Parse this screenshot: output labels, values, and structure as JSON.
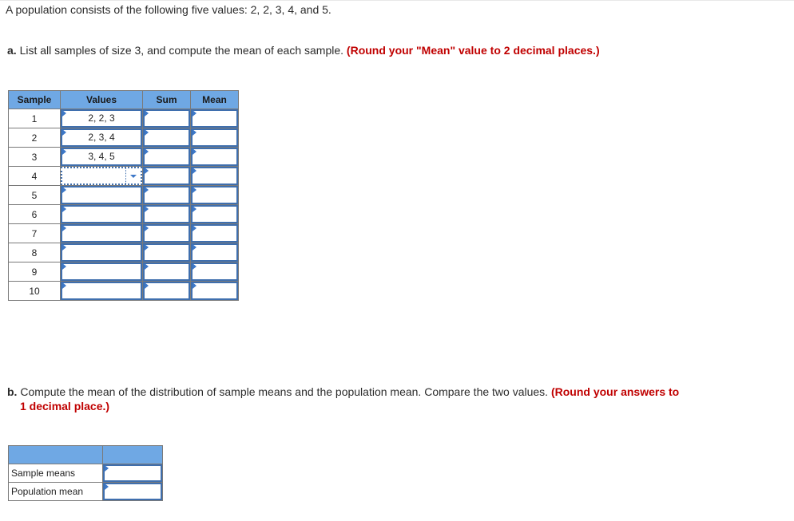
{
  "question": {
    "intro": "A population consists of the following five values: 2, 2, 3, 4, and 5.",
    "part_a": {
      "label": "a.",
      "text": "List all samples of size 3, and compute the mean of each sample.",
      "instruction": "(Round your \"Mean\" value to 2 decimal places.)"
    },
    "part_b": {
      "label": "b.",
      "text": "Compute the mean of the distribution of sample means and the population mean. Compare the two values.",
      "instruction_line1": "(Round your answers to",
      "instruction_line2": "1 decimal place.)"
    }
  },
  "samples_table": {
    "headers": [
      "Sample",
      "Values",
      "Sum",
      "Mean"
    ],
    "rows": [
      {
        "sample": "1",
        "values": "2, 2, 3",
        "sum": "",
        "mean": ""
      },
      {
        "sample": "2",
        "values": "2, 3, 4",
        "sum": "",
        "mean": ""
      },
      {
        "sample": "3",
        "values": "3, 4, 5",
        "sum": "",
        "mean": ""
      },
      {
        "sample": "4",
        "values": "",
        "sum": "",
        "mean": ""
      },
      {
        "sample": "5",
        "values": "",
        "sum": "",
        "mean": ""
      },
      {
        "sample": "6",
        "values": "",
        "sum": "",
        "mean": ""
      },
      {
        "sample": "7",
        "values": "",
        "sum": "",
        "mean": ""
      },
      {
        "sample": "8",
        "values": "",
        "sum": "",
        "mean": ""
      },
      {
        "sample": "9",
        "values": "",
        "sum": "",
        "mean": ""
      },
      {
        "sample": "10",
        "values": "",
        "sum": "",
        "mean": ""
      }
    ]
  },
  "means_table": {
    "headers": [
      "",
      ""
    ],
    "rows": [
      {
        "label": "Sample means",
        "value": ""
      },
      {
        "label": "Population mean",
        "value": ""
      }
    ]
  },
  "colors": {
    "header_bg": "#6fa8e4",
    "input_border": "#3f6fae",
    "instruction_red": "#c00000"
  }
}
